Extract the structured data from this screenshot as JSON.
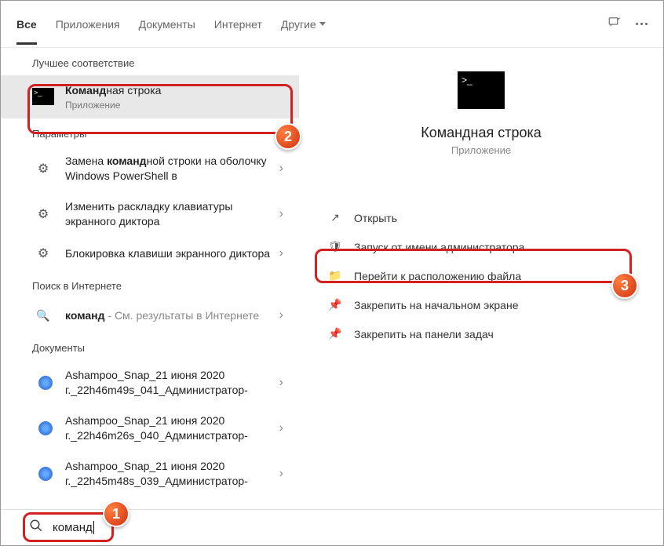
{
  "header": {
    "tabs": {
      "all": "Все",
      "apps": "Приложения",
      "docs": "Документы",
      "web": "Интернет",
      "more": "Другие"
    }
  },
  "left": {
    "sections": {
      "best": "Лучшее соответствие",
      "settings": "Параметры",
      "web": "Поиск в Интернете",
      "docs": "Документы"
    },
    "best": {
      "title_pre": "Команд",
      "title_post": "ная строка",
      "sub": "Приложение"
    },
    "settings": [
      {
        "pre": "Замена ",
        "bold": "команд",
        "post": "ной строки на оболочку Windows PowerShell в"
      },
      {
        "pre": "Изменить раскладку клавиатуры экранного диктора",
        "bold": "",
        "post": ""
      },
      {
        "pre": "Блокировка клавиши экранного диктора",
        "bold": "",
        "post": ""
      }
    ],
    "web": {
      "bold": "команд",
      "tail": " - См. результаты в Интернете"
    },
    "docs": [
      "Ashampoo_Snap_21 июня 2020 г._22h46m49s_041_Администратор-",
      "Ashampoo_Snap_21 июня 2020 г._22h46m26s_040_Администратор-",
      "Ashampoo_Snap_21 июня 2020 г._22h45m48s_039_Администратор-"
    ]
  },
  "right": {
    "title": "Командная строка",
    "sub": "Приложение",
    "actions": {
      "open": "Открыть",
      "admin": "Запуск от имени администратора",
      "location": "Перейти к расположению файла",
      "pin_start": "Закрепить на начальном экране",
      "pin_taskbar": "Закрепить на панели задач"
    }
  },
  "search": {
    "value": "команд"
  },
  "badges": {
    "b1": "1",
    "b2": "2",
    "b3": "3"
  }
}
